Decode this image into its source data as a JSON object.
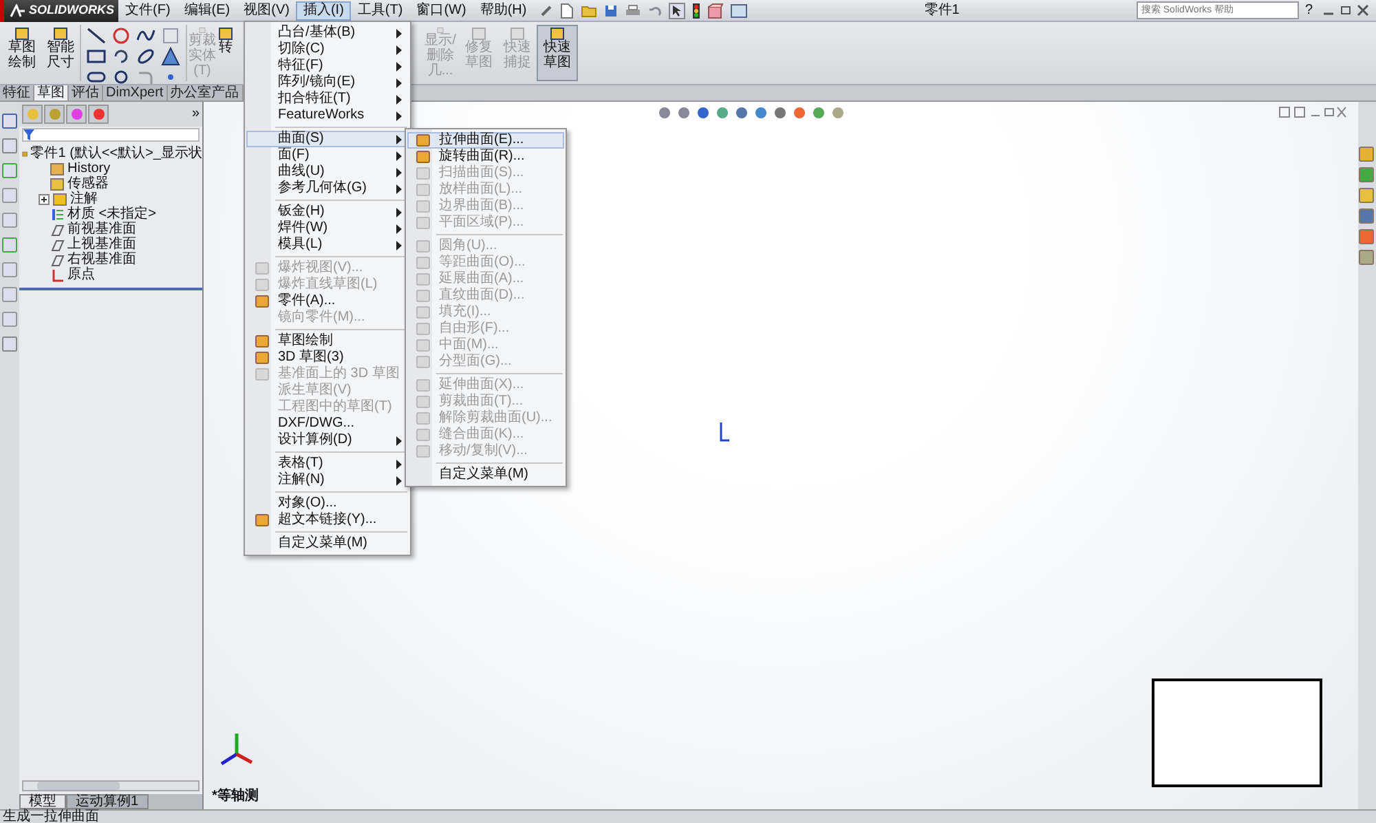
{
  "window": {
    "logo": "SOLIDWORKS",
    "title": "零件1",
    "search": {
      "placeholder": "搜索 SolidWorks 帮助"
    },
    "help": "?"
  },
  "menubar": [
    {
      "label": "文件(F)",
      "selected": false
    },
    {
      "label": "编辑(E)",
      "selected": false
    },
    {
      "label": "视图(V)",
      "selected": false
    },
    {
      "label": "插入(I)",
      "selected": true
    },
    {
      "label": "工具(T)",
      "selected": false
    },
    {
      "label": "窗口(W)",
      "selected": false
    },
    {
      "label": "帮助(H)",
      "selected": false
    }
  ],
  "ribbon": {
    "left": [
      {
        "label": "草图绘制",
        "kind": "large",
        "disabled": false,
        "pressed": false
      },
      {
        "label": "智能尺寸",
        "kind": "large",
        "disabled": false,
        "pressed": false
      },
      {
        "kind": "grid"
      },
      {
        "label": "剪裁实体(T)",
        "kind": "large",
        "disabled": true,
        "pressed": false
      },
      {
        "label": "转",
        "kind": "large",
        "disabled": false,
        "pressed": false
      }
    ],
    "right": [
      {
        "label": "显示/删除几...",
        "kind": "large",
        "disabled": true,
        "pressed": false
      },
      {
        "label": "修复草图",
        "kind": "large",
        "disabled": true,
        "pressed": false
      },
      {
        "label": "快速捕捉",
        "kind": "large",
        "disabled": true,
        "pressed": false
      },
      {
        "label": "快速草图",
        "kind": "large",
        "disabled": false,
        "pressed": true
      }
    ]
  },
  "tabs": [
    {
      "label": "特征",
      "selected": false
    },
    {
      "label": "草图",
      "selected": true
    },
    {
      "label": "评估",
      "selected": false
    },
    {
      "label": "DimXpert",
      "selected": false
    },
    {
      "label": "办公室产品",
      "selected": false
    }
  ],
  "feature_tree": {
    "more": "»",
    "items": [
      {
        "label": "零件1 (默认<<默认>_显示状",
        "kind": "part",
        "collapsed": false,
        "children": [
          {
            "label": "History",
            "kind": "history",
            "collapsed": false
          },
          {
            "label": "传感器",
            "kind": "sensor",
            "collapsed": false
          },
          {
            "label": "注解",
            "kind": "annotation",
            "collapsed": true
          },
          {
            "label": "材质 <未指定>",
            "kind": "material",
            "collapsed": false
          },
          {
            "label": "前视基准面",
            "kind": "plane",
            "collapsed": false
          },
          {
            "label": "上视基准面",
            "kind": "plane",
            "collapsed": false
          },
          {
            "label": "右视基准面",
            "kind": "plane",
            "collapsed": false
          },
          {
            "label": "原点",
            "kind": "origin",
            "collapsed": false
          }
        ]
      }
    ]
  },
  "insert_menu": [
    {
      "kind": "item",
      "label": "凸台/基体(B)",
      "submenu": true,
      "disabled": false,
      "selected": false,
      "icon": false
    },
    {
      "kind": "item",
      "label": "切除(C)",
      "submenu": true,
      "disabled": false,
      "selected": false,
      "icon": false
    },
    {
      "kind": "item",
      "label": "特征(F)",
      "submenu": true,
      "disabled": false,
      "selected": false,
      "icon": false
    },
    {
      "kind": "item",
      "label": "阵列/镜向(E)",
      "submenu": true,
      "disabled": false,
      "selected": false,
      "icon": false
    },
    {
      "kind": "item",
      "label": "扣合特征(T)",
      "submenu": true,
      "disabled": false,
      "selected": false,
      "icon": false
    },
    {
      "kind": "item",
      "label": "FeatureWorks",
      "submenu": true,
      "disabled": false,
      "selected": false,
      "icon": false
    },
    {
      "kind": "separator"
    },
    {
      "kind": "item",
      "label": "曲面(S)",
      "submenu": true,
      "disabled": false,
      "selected": true,
      "icon": false
    },
    {
      "kind": "item",
      "label": "面(F)",
      "submenu": true,
      "disabled": false,
      "selected": false,
      "icon": false
    },
    {
      "kind": "item",
      "label": "曲线(U)",
      "submenu": true,
      "disabled": false,
      "selected": false,
      "icon": false
    },
    {
      "kind": "item",
      "label": "参考几何体(G)",
      "submenu": true,
      "disabled": false,
      "selected": false,
      "icon": false
    },
    {
      "kind": "separator"
    },
    {
      "kind": "item",
      "label": "钣金(H)",
      "submenu": true,
      "disabled": false,
      "selected": false,
      "icon": false
    },
    {
      "kind": "item",
      "label": "焊件(W)",
      "submenu": true,
      "disabled": false,
      "selected": false,
      "icon": false
    },
    {
      "kind": "item",
      "label": "模具(L)",
      "submenu": true,
      "disabled": false,
      "selected": false,
      "icon": false
    },
    {
      "kind": "separator"
    },
    {
      "kind": "item",
      "label": "爆炸视图(V)...",
      "submenu": false,
      "disabled": true,
      "selected": false,
      "icon": true
    },
    {
      "kind": "item",
      "label": "爆炸直线草图(L)",
      "submenu": false,
      "disabled": true,
      "selected": false,
      "icon": true
    },
    {
      "kind": "item",
      "label": "零件(A)...",
      "submenu": false,
      "disabled": false,
      "selected": false,
      "icon": true
    },
    {
      "kind": "item",
      "label": "镜向零件(M)...",
      "submenu": false,
      "disabled": true,
      "selected": false,
      "icon": false
    },
    {
      "kind": "separator"
    },
    {
      "kind": "item",
      "label": "草图绘制",
      "submenu": false,
      "disabled": false,
      "selected": false,
      "icon": true
    },
    {
      "kind": "item",
      "label": "3D 草图(3)",
      "submenu": false,
      "disabled": false,
      "selected": false,
      "icon": true
    },
    {
      "kind": "item",
      "label": "基准面上的 3D 草图",
      "submenu": false,
      "disabled": true,
      "selected": false,
      "icon": true
    },
    {
      "kind": "item",
      "label": "派生草图(V)",
      "submenu": false,
      "disabled": true,
      "selected": false,
      "icon": false
    },
    {
      "kind": "item",
      "label": "工程图中的草图(T)",
      "submenu": false,
      "disabled": true,
      "selected": false,
      "icon": false
    },
    {
      "kind": "item",
      "label": "DXF/DWG...",
      "submenu": false,
      "disabled": false,
      "selected": false,
      "icon": false
    },
    {
      "kind": "item",
      "label": "设计算例(D)",
      "submenu": true,
      "disabled": false,
      "selected": false,
      "icon": false
    },
    {
      "kind": "separator"
    },
    {
      "kind": "item",
      "label": "表格(T)",
      "submenu": true,
      "disabled": false,
      "selected": false,
      "icon": false
    },
    {
      "kind": "item",
      "label": "注解(N)",
      "submenu": true,
      "disabled": false,
      "selected": false,
      "icon": false
    },
    {
      "kind": "separator"
    },
    {
      "kind": "item",
      "label": "对象(O)...",
      "submenu": false,
      "disabled": false,
      "selected": false,
      "icon": false
    },
    {
      "kind": "item",
      "label": "超文本链接(Y)...",
      "submenu": false,
      "disabled": false,
      "selected": false,
      "icon": true
    },
    {
      "kind": "separator"
    },
    {
      "kind": "item",
      "label": "自定义菜单(M)",
      "submenu": false,
      "disabled": false,
      "selected": false,
      "icon": false
    }
  ],
  "surface_menu": [
    {
      "kind": "item",
      "label": "拉伸曲面(E)...",
      "disabled": false,
      "selected": true,
      "icon": true
    },
    {
      "kind": "item",
      "label": "旋转曲面(R)...",
      "disabled": false,
      "selected": false,
      "icon": true
    },
    {
      "kind": "item",
      "label": "扫描曲面(S)...",
      "disabled": true,
      "selected": false,
      "icon": true
    },
    {
      "kind": "item",
      "label": "放样曲面(L)...",
      "disabled": true,
      "selected": false,
      "icon": true
    },
    {
      "kind": "item",
      "label": "边界曲面(B)...",
      "disabled": true,
      "selected": false,
      "icon": true
    },
    {
      "kind": "item",
      "label": "平面区域(P)...",
      "disabled": true,
      "selected": false,
      "icon": true
    },
    {
      "kind": "separator"
    },
    {
      "kind": "item",
      "label": "圆角(U)...",
      "disabled": true,
      "selected": false,
      "icon": true
    },
    {
      "kind": "item",
      "label": "等距曲面(O)...",
      "disabled": true,
      "selected": false,
      "icon": true
    },
    {
      "kind": "item",
      "label": "延展曲面(A)...",
      "disabled": true,
      "selected": false,
      "icon": true
    },
    {
      "kind": "item",
      "label": "直纹曲面(D)...",
      "disabled": true,
      "selected": false,
      "icon": true
    },
    {
      "kind": "item",
      "label": "填充(I)...",
      "disabled": true,
      "selected": false,
      "icon": true
    },
    {
      "kind": "item",
      "label": "自由形(F)...",
      "disabled": true,
      "selected": false,
      "icon": true
    },
    {
      "kind": "item",
      "label": "中面(M)...",
      "disabled": true,
      "selected": false,
      "icon": true
    },
    {
      "kind": "item",
      "label": "分型面(G)...",
      "disabled": true,
      "selected": false,
      "icon": true
    },
    {
      "kind": "separator"
    },
    {
      "kind": "item",
      "label": "延伸曲面(X)...",
      "disabled": true,
      "selected": false,
      "icon": true
    },
    {
      "kind": "item",
      "label": "剪裁曲面(T)...",
      "disabled": true,
      "selected": false,
      "icon": true
    },
    {
      "kind": "item",
      "label": "解除剪裁曲面(U)...",
      "disabled": true,
      "selected": false,
      "icon": true
    },
    {
      "kind": "item",
      "label": "缝合曲面(K)...",
      "disabled": true,
      "selected": false,
      "icon": true
    },
    {
      "kind": "item",
      "label": "移动/复制(V)...",
      "disabled": true,
      "selected": false,
      "icon": true
    },
    {
      "kind": "separator"
    },
    {
      "kind": "item",
      "label": "自定义菜单(M)",
      "disabled": false,
      "selected": false,
      "icon": false
    }
  ],
  "view": {
    "label": "*等轴测"
  },
  "bottom_tabs": [
    {
      "label": "模型",
      "selected": true
    },
    {
      "label": "运动算例1",
      "selected": false
    }
  ],
  "status_bar": {
    "text": "生成一拉伸曲面"
  }
}
